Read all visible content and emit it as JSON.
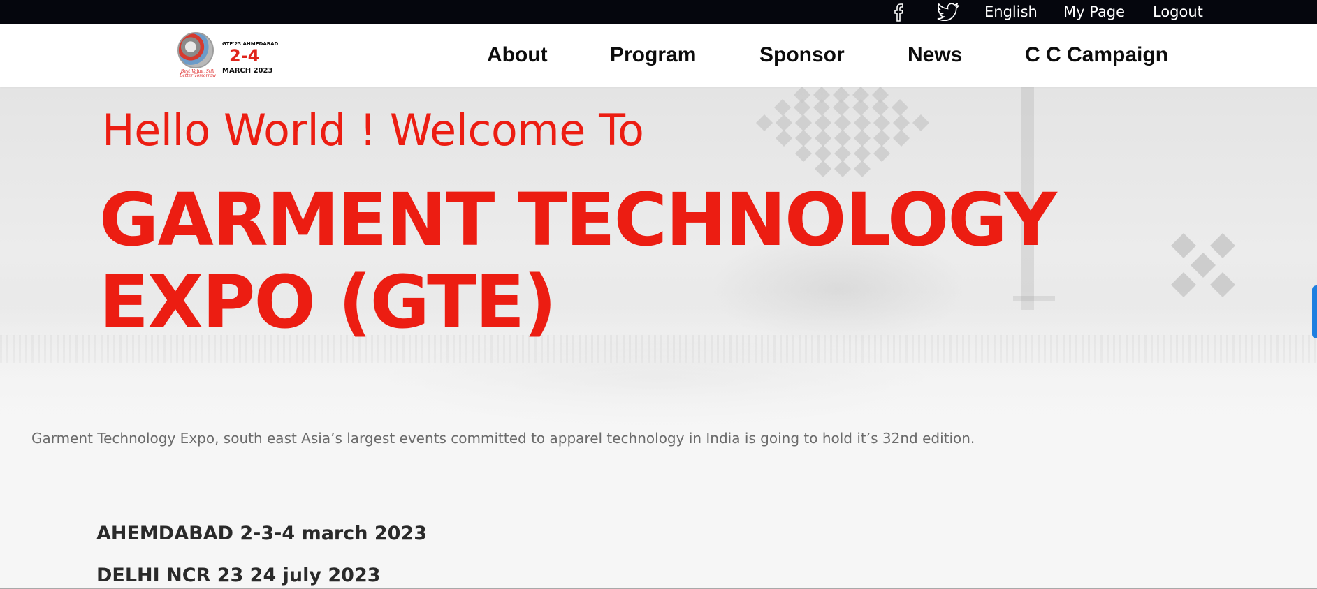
{
  "topbar": {
    "social": [
      "facebook-icon",
      "twitter-icon"
    ],
    "language": "English",
    "my_page": "My Page",
    "logout": "Logout"
  },
  "logo": {
    "line1": "GTE'23 AHMEDABAD",
    "dates": "2-4",
    "month": "MARCH 2023",
    "tagline": "Best Value, Still Better Tomorrow"
  },
  "nav": {
    "items": [
      "About",
      "Program",
      "Sponsor",
      "News",
      "C C Campaign"
    ]
  },
  "hero": {
    "greeting": "Hello World ! Welcome To",
    "title": "GARMENT TECHNOLOGY EXPO (GTE)"
  },
  "intro": "Garment Technology Expo, south east Asia’s largest events committed to apparel technology in India is going to hold it’s 32nd edition.",
  "events": [
    "AHEMDABAD 2-3-4 march 2023",
    "DELHI NCR 23 24 july 2023"
  ],
  "colors": {
    "accent": "#ec1d12",
    "topbar_bg": "#05060d",
    "scroll_tab": "#1e7fe0"
  }
}
